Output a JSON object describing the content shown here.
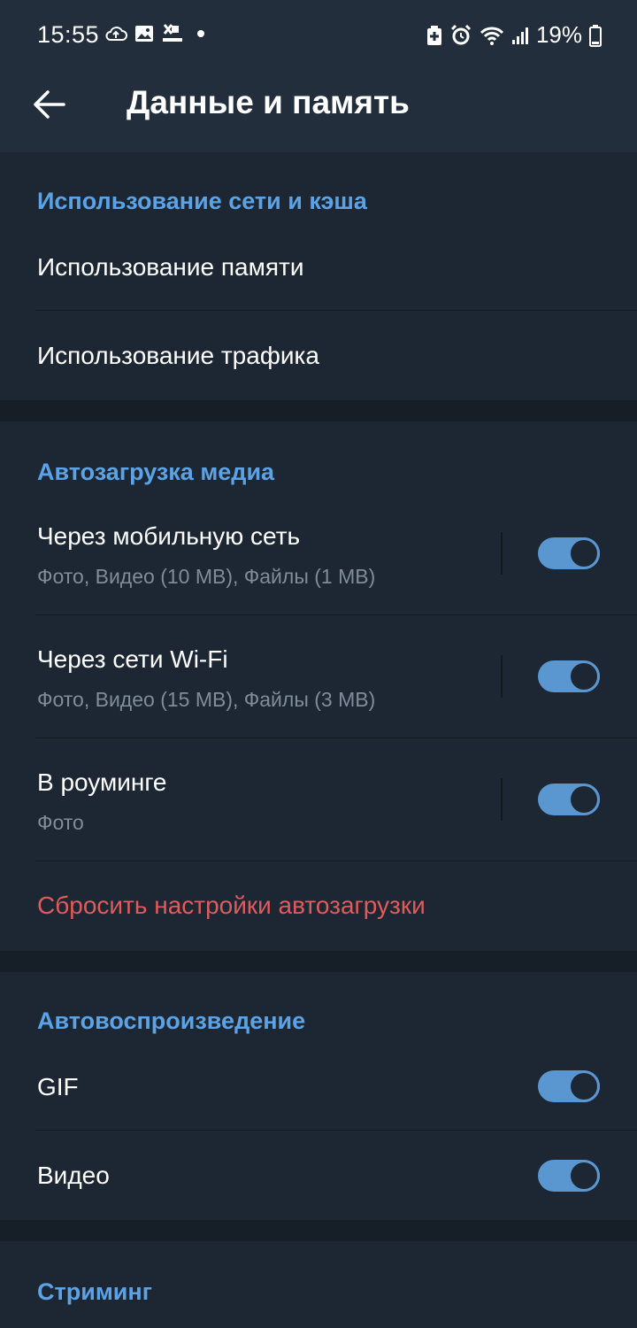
{
  "status_bar": {
    "time": "15:55",
    "battery_percent": "19%",
    "left_icons": [
      "cloud-upload-icon",
      "gallery-icon",
      "vpok-icon",
      "dot-icon"
    ],
    "right_icons": [
      "battery-saver-icon",
      "alarm-icon",
      "wifi-icon",
      "signal-icon",
      "battery-icon"
    ]
  },
  "app_bar": {
    "title": "Данные и память"
  },
  "network_section": {
    "header": "Использование сети и кэша",
    "items": [
      {
        "label": "Использование памяти"
      },
      {
        "label": "Использование трафика"
      }
    ]
  },
  "autoload_section": {
    "header": "Автозагрузка медиа",
    "items": [
      {
        "label": "Через мобильную сеть",
        "sub": "Фото, Видео (10 MB), Файлы (1 MB)",
        "enabled": true
      },
      {
        "label": "Через сети Wi-Fi",
        "sub": "Фото, Видео (15 MB), Файлы (3 MB)",
        "enabled": true
      },
      {
        "label": "В роуминге",
        "sub": "Фото",
        "enabled": true
      }
    ],
    "reset_label": "Сбросить настройки автозагрузки"
  },
  "autoplay_section": {
    "header": "Автовоспроизведение",
    "items": [
      {
        "label": "GIF",
        "enabled": true
      },
      {
        "label": "Видео",
        "enabled": true
      }
    ]
  },
  "streaming_section": {
    "header": "Стриминг"
  },
  "colors": {
    "background": "#1d2733",
    "bar": "#222e3b",
    "accent": "#5ba3e6",
    "toggle": "#5a97d1",
    "danger": "#e05b5b",
    "subtext": "#7f8c99"
  }
}
